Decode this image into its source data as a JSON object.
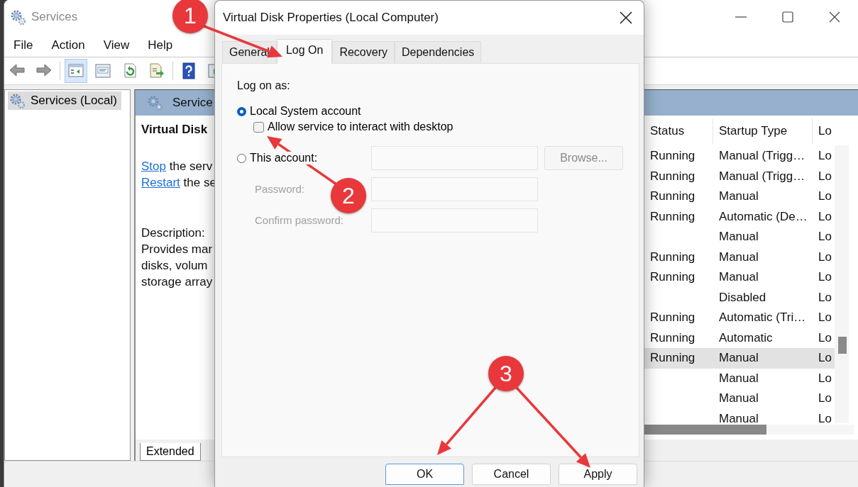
{
  "services_window": {
    "title": "Services",
    "menu": [
      "File",
      "Action",
      "View",
      "Help"
    ],
    "toolbar": [
      {
        "kind": "back",
        "selected": false
      },
      {
        "kind": "forward",
        "selected": false
      },
      {
        "kind": "tree",
        "selected": true
      },
      {
        "kind": "properties",
        "selected": false
      },
      {
        "kind": "refresh",
        "selected": false
      },
      {
        "kind": "export",
        "selected": false
      },
      {
        "kind": "help",
        "selected": false
      },
      {
        "kind": "play",
        "selected": false
      }
    ],
    "tree": [
      {
        "label": "Services (Local)",
        "selected": true
      }
    ],
    "details": {
      "header": "Service",
      "service_name": "Virtual Disk",
      "actions": [
        {
          "link": "Stop",
          "text": " the serv"
        },
        {
          "link": "Restart",
          "text": " the se"
        }
      ],
      "description_label": "Description:",
      "description_lines": [
        "Provides mar",
        "disks, volum",
        "storage array"
      ]
    },
    "table": {
      "columns": [
        "Status",
        "Startup Type",
        "Lo"
      ],
      "rows": [
        {
          "status": "Running",
          "startup_type": "Manual (Trigg…",
          "column_3": "Lo",
          "selected": false
        },
        {
          "status": "Running",
          "startup_type": "Manual (Trigg…",
          "column_3": "Lo",
          "selected": false
        },
        {
          "status": "Running",
          "startup_type": "Manual",
          "column_3": "Lo",
          "selected": false
        },
        {
          "status": "Running",
          "startup_type": "Automatic (De…",
          "column_3": "Lo",
          "selected": false
        },
        {
          "startup_type": "Manual",
          "column_3": "Lo",
          "selected": false
        },
        {
          "status": "Running",
          "startup_type": "Manual",
          "column_3": "Lo",
          "selected": false
        },
        {
          "status": "Running",
          "startup_type": "Manual",
          "column_3": "Lo",
          "selected": false
        },
        {
          "startup_type": "Disabled",
          "column_3": "Lo",
          "selected": false
        },
        {
          "status": "Running",
          "startup_type": "Automatic (Tri…",
          "column_3": "Lo",
          "selected": false
        },
        {
          "status": "Running",
          "startup_type": "Automatic",
          "column_3": "Lo",
          "selected": false
        },
        {
          "status": "Running",
          "startup_type": "Manual",
          "column_3": "Lo",
          "selected": true
        },
        {
          "startup_type": "Manual",
          "column_3": "Lo",
          "selected": false
        },
        {
          "startup_type": "Manual",
          "column_3": "Lo",
          "selected": false
        },
        {
          "startup_type": "Manual",
          "column_3": "Lo",
          "selected": false
        }
      ]
    },
    "bottom_tabs": [
      {
        "label": "Extended",
        "selected": true
      }
    ]
  },
  "dialog": {
    "title": "Virtual Disk Properties (Local Computer)",
    "tabs": [
      {
        "label": "General",
        "selected": false
      },
      {
        "label": "Log On",
        "selected": true
      },
      {
        "label": "Recovery",
        "selected": false
      },
      {
        "label": "Dependencies",
        "selected": false
      }
    ],
    "log_on_as_label": "Log on as:",
    "options": [
      {
        "label": "Local System account",
        "selected": true
      },
      {
        "label": "This account:",
        "selected": false
      }
    ],
    "interact_checkbox": {
      "label": "Allow service to interact with desktop",
      "checked": false
    },
    "account_field": {
      "disabled": true
    },
    "browse_button": {
      "label": "Browse...",
      "disabled": true
    },
    "password": {
      "label": "Password:",
      "disabled": true
    },
    "confirm_password": {
      "label": "Confirm password:",
      "disabled": true
    },
    "buttons": [
      {
        "label": "OK",
        "default": true
      },
      {
        "label": "Cancel",
        "default": false
      },
      {
        "label": "Apply",
        "default": false
      }
    ]
  },
  "annotations": [
    {
      "label": "1"
    },
    {
      "label": "2"
    },
    {
      "label": "3"
    }
  ]
}
